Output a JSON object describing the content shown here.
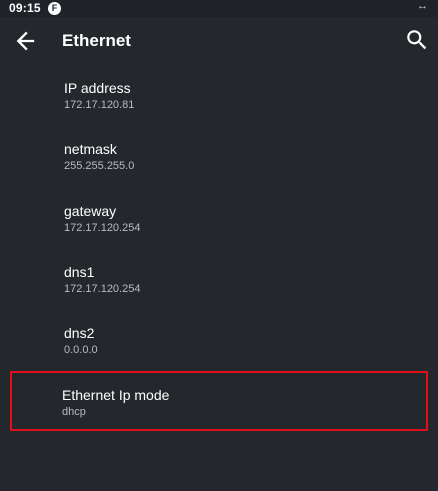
{
  "status_bar": {
    "time": "09:15",
    "app_icon": "F",
    "sync_icon": "↔"
  },
  "app_bar": {
    "title": "Ethernet",
    "back_icon": "arrow-back-icon",
    "search_icon": "search-icon"
  },
  "items": [
    {
      "title": "IP address",
      "value": "172.17.120.81"
    },
    {
      "title": "netmask",
      "value": "255.255.255.0"
    },
    {
      "title": "gateway",
      "value": "172.17.120.254"
    },
    {
      "title": "dns1",
      "value": "172.17.120.254"
    },
    {
      "title": "dns2",
      "value": "0.0.0.0"
    },
    {
      "title": "Ethernet Ip mode",
      "value": "dhcp"
    }
  ],
  "highlight_color": "#e0101b"
}
